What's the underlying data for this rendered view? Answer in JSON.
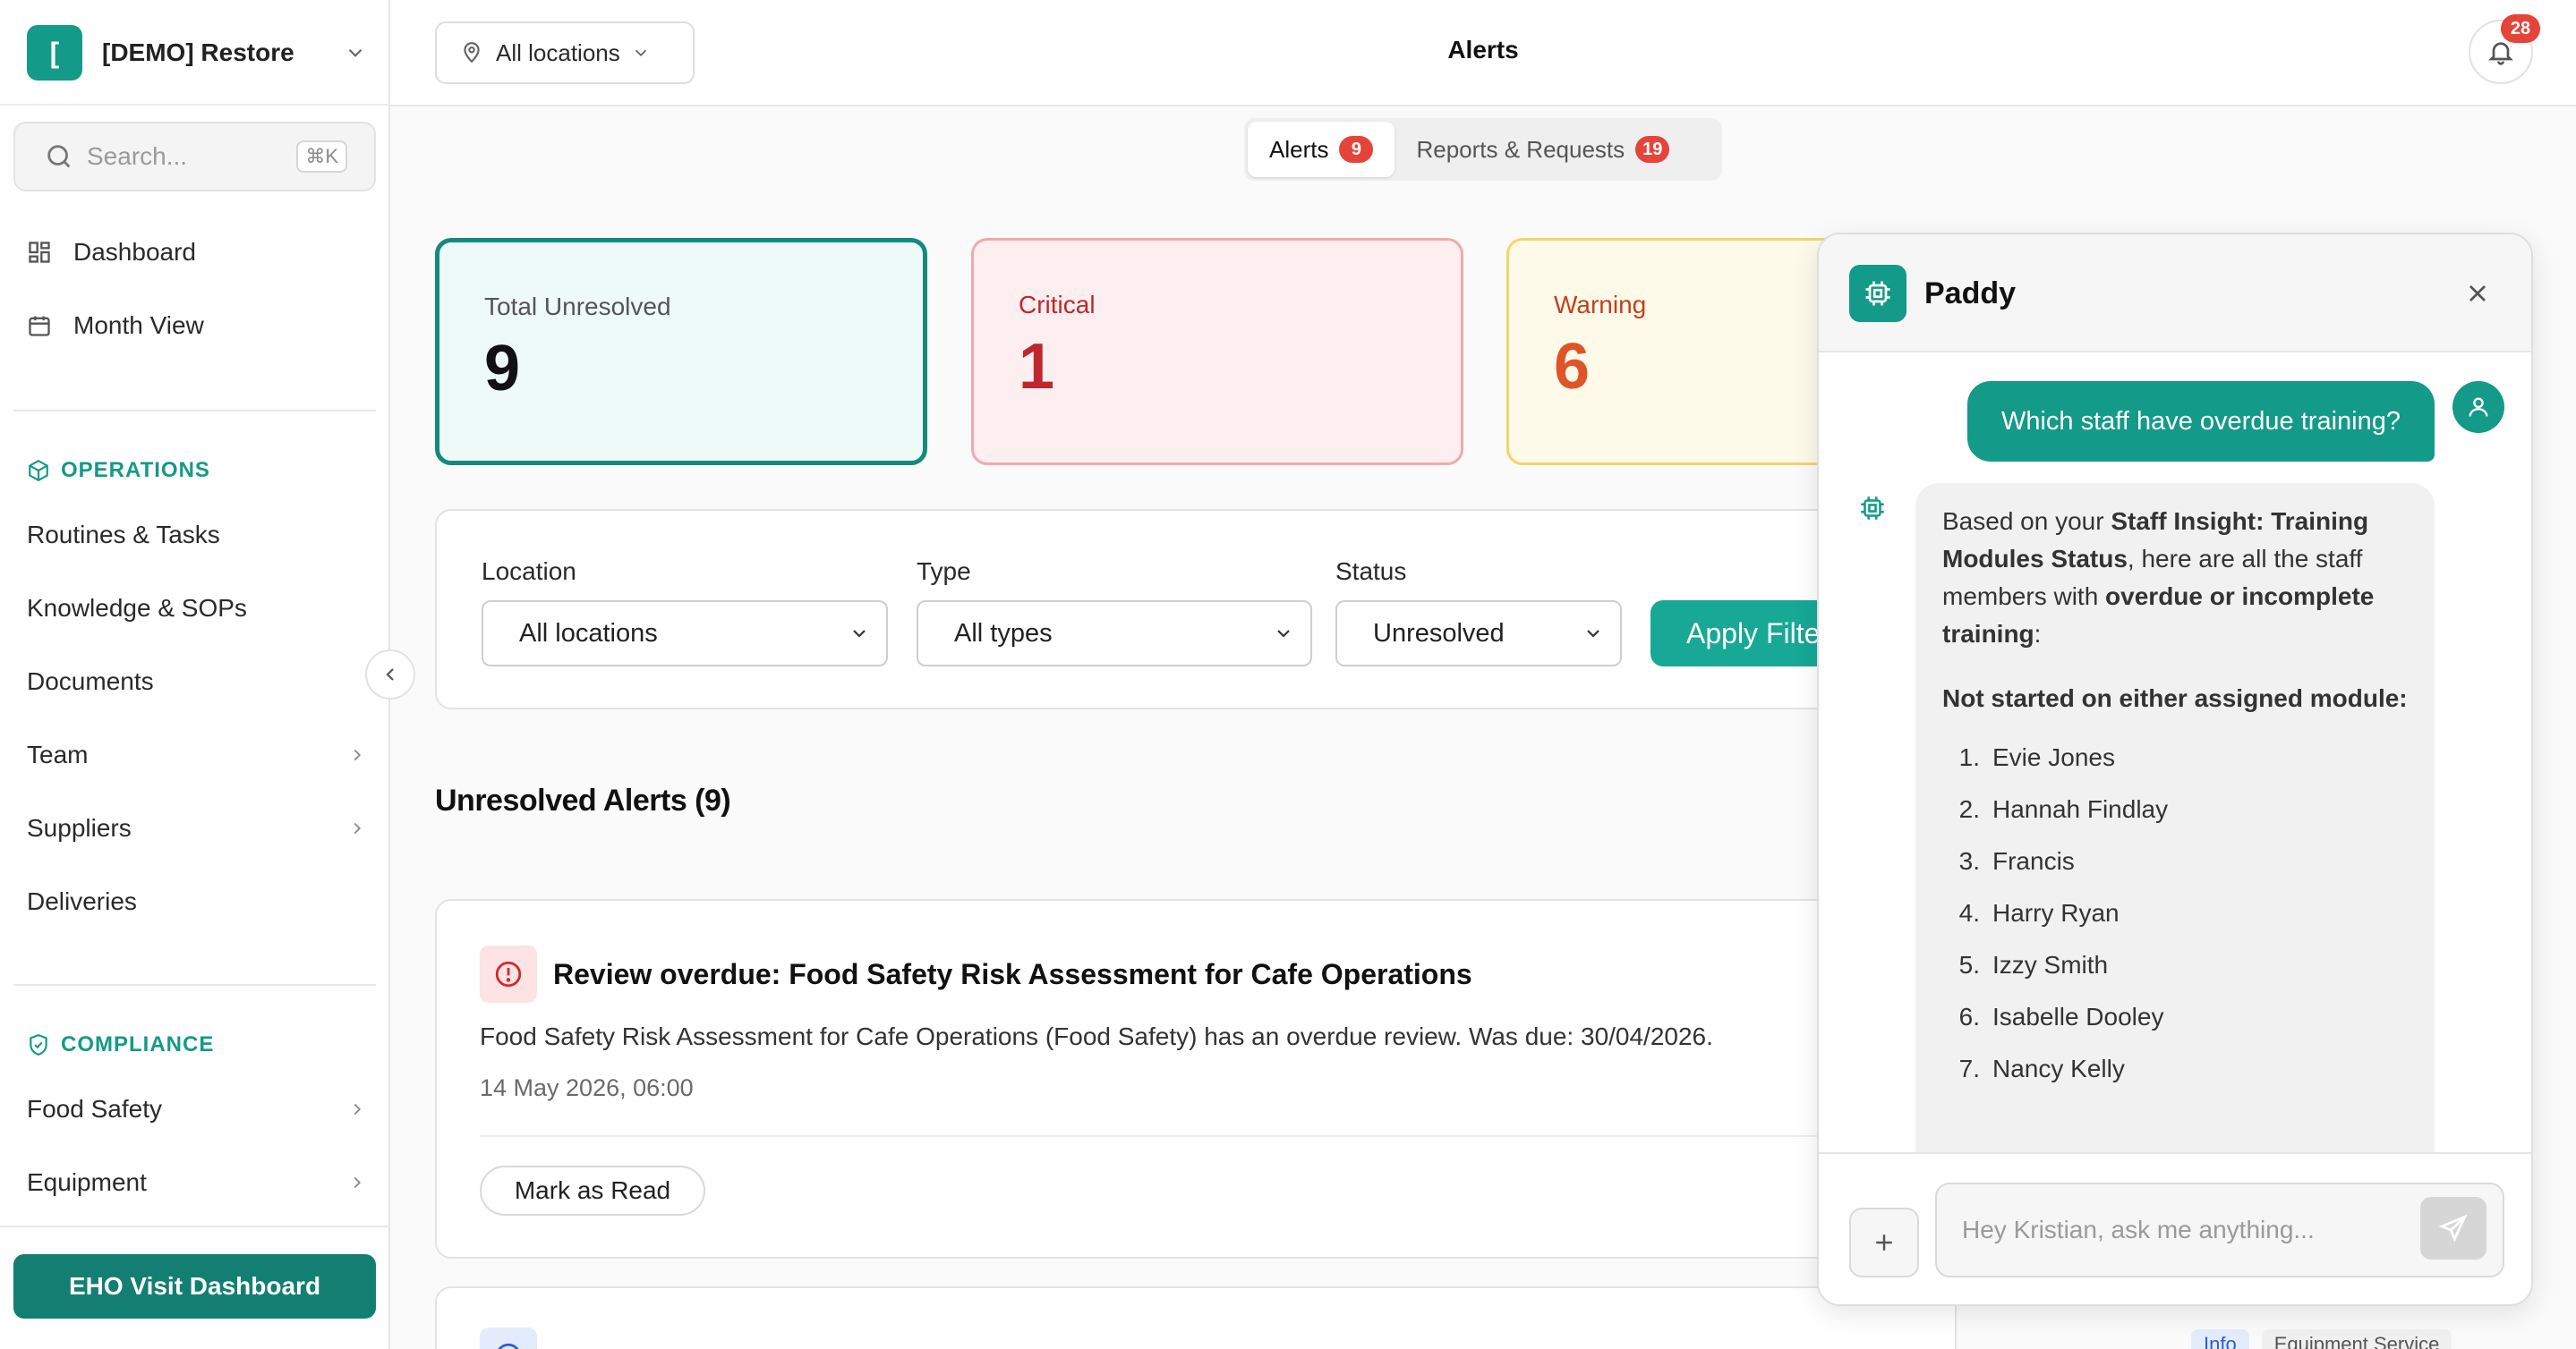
{
  "org": {
    "logo_text": "[",
    "name": "[DEMO] Restore"
  },
  "search": {
    "placeholder": "Search...",
    "shortcut": "⌘K"
  },
  "nav": {
    "dashboard": "Dashboard",
    "month_view": "Month View",
    "operations_title": "OPERATIONS",
    "routines": "Routines & Tasks",
    "knowledge": "Knowledge & SOPs",
    "documents": "Documents",
    "team": "Team",
    "suppliers": "Suppliers",
    "deliveries": "Deliveries",
    "compliance_title": "COMPLIANCE",
    "food_safety": "Food Safety",
    "equipment": "Equipment"
  },
  "eho_button": "EHO Visit Dashboard",
  "topbar": {
    "location": "All locations",
    "title": "Alerts",
    "notification_count": "28"
  },
  "tabs": [
    {
      "label": "Alerts",
      "count": "9"
    },
    {
      "label": "Reports & Requests",
      "count": "19"
    }
  ],
  "stats": {
    "total": {
      "label": "Total Unresolved",
      "value": "9"
    },
    "critical": {
      "label": "Critical",
      "value": "1"
    },
    "warning": {
      "label": "Warning",
      "value": "6"
    }
  },
  "filters": {
    "location_label": "Location",
    "location_value": "All locations",
    "type_label": "Type",
    "type_value": "All types",
    "status_label": "Status",
    "status_value": "Unresolved",
    "apply_label": "Apply Filters"
  },
  "section_title": "Unresolved Alerts (9)",
  "alert": {
    "title": "Review overdue: Food Safety Risk Assessment for Cafe Operations",
    "description": "Food Safety Risk Assessment for Cafe Operations (Food Safety) has an overdue review. Was due: 30/04/2026.",
    "timestamp": "14 May 2026, 06:00",
    "mark_read": "Mark as Read"
  },
  "alert2": {
    "tag_level": "Info",
    "tag_category": "Equipment Service"
  },
  "paddy": {
    "name": "Paddy",
    "user_message": "Which staff have overdue training?",
    "reply_p1": "Based on your ",
    "reply_p1_bold": "Staff Insight: Training Modules Status",
    "reply_p1_mid": ", here are all the staff members with ",
    "reply_p1_bold2": "overdue or incomplete training",
    "reply_p1_end": ":",
    "reply_heading": "Not started on either assigned module:",
    "staff": [
      "Evie Jones",
      "Hannah Findlay",
      "Francis",
      "Harry Ryan",
      "Izzy Smith",
      "Isabelle Dooley",
      "Nancy Kelly"
    ],
    "input_placeholder": "Hey Kristian, ask me anything..."
  },
  "colors": {
    "brand": "#149a88",
    "critical": "#c0262d",
    "warning": "#e0542a",
    "badge": "#e5443a"
  }
}
